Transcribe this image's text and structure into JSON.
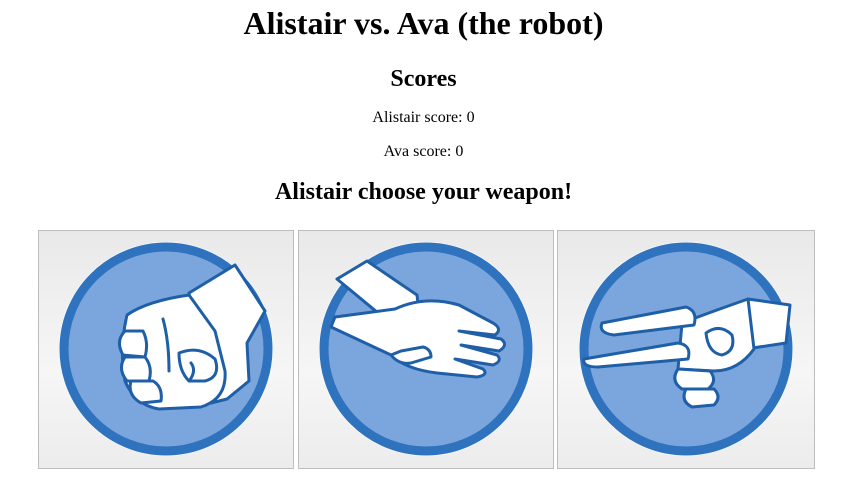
{
  "title": "Alistair vs. Ava (the robot)",
  "scores": {
    "heading": "Scores",
    "alistair": "Alistair score: 0",
    "ava": "Ava score: 0"
  },
  "prompt": "Alistair choose your weapon!",
  "weapons": [
    {
      "name": "rock",
      "icon": "rock-fist-icon"
    },
    {
      "name": "paper",
      "icon": "paper-hand-icon"
    },
    {
      "name": "scissors",
      "icon": "scissors-hand-icon"
    }
  ],
  "colors": {
    "circle_fill": "#7aa5dd",
    "circle_ring": "#2f72bd",
    "hand_fill": "#ffffff",
    "hand_stroke": "#1f5fa8",
    "card_border": "#bdbdbd"
  }
}
